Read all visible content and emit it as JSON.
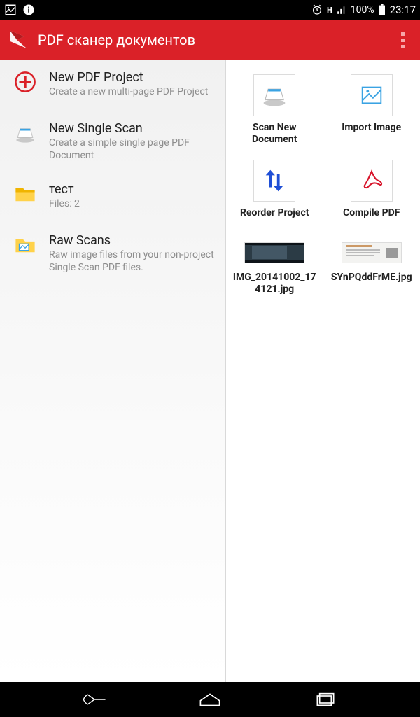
{
  "status": {
    "battery_pct": "100%",
    "time": "23:17",
    "net_label": "H"
  },
  "appbar": {
    "title": "PDF сканер документов"
  },
  "left_list": [
    {
      "title": "New PDF Project",
      "subtitle": "Create a new multi-page PDF Project"
    },
    {
      "title": "New Single Scan",
      "subtitle": "Create a simple single page PDF Document"
    },
    {
      "title": "тест",
      "subtitle": "Files: 2"
    },
    {
      "title": "Raw Scans",
      "subtitle": "Raw image files from your non-project Single Scan PDF files."
    }
  ],
  "actions": [
    {
      "label": "Scan New Document"
    },
    {
      "label": "Import Image"
    },
    {
      "label": "Reorder Project"
    },
    {
      "label": "Compile PDF"
    }
  ],
  "files": [
    {
      "label": "IMG_20141002_174121.jpg"
    },
    {
      "label": "SYnPQddFrME.jpg"
    }
  ]
}
